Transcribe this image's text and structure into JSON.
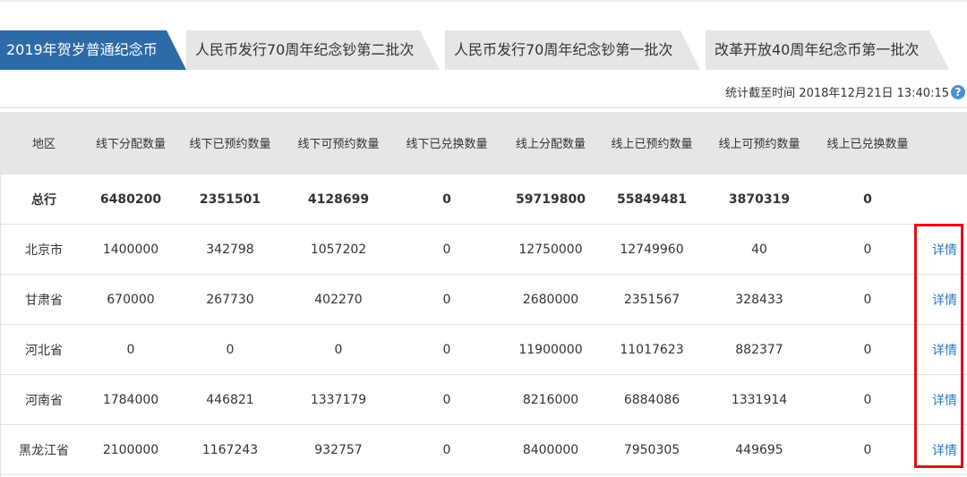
{
  "tabs": [
    {
      "label": "2019年贺岁普通纪念币",
      "active": true
    },
    {
      "label": "人民币发行70周年纪念钞第二批次",
      "active": false
    },
    {
      "label": "人民币发行70周年纪念钞第一批次",
      "active": false
    },
    {
      "label": "改革开放40周年纪念币第一批次",
      "active": false
    }
  ],
  "stat_time": "统计截至时间 2018年12月21日 13:40:15",
  "help_icon": "?",
  "columns": [
    "地区",
    "线下分配数量",
    "线下已预约数量",
    "线下可预约数量",
    "线下已兑换数量",
    "线上分配数量",
    "线上已预约数量",
    "线上可预约数量",
    "线上已兑换数量",
    ""
  ],
  "total_row": [
    "总行",
    "6480200",
    "2351501",
    "4128699",
    "0",
    "59719800",
    "55849481",
    "3870319",
    "0"
  ],
  "rows": [
    [
      "北京市",
      "1400000",
      "342798",
      "1057202",
      "0",
      "12750000",
      "12749960",
      "40",
      "0"
    ],
    [
      "甘肃省",
      "670000",
      "267730",
      "402270",
      "0",
      "2680000",
      "2351567",
      "328433",
      "0"
    ],
    [
      "河北省",
      "0",
      "0",
      "0",
      "0",
      "11900000",
      "11017623",
      "882377",
      "0"
    ],
    [
      "河南省",
      "1784000",
      "446821",
      "1337179",
      "0",
      "8216000",
      "6884086",
      "1331914",
      "0"
    ],
    [
      "黑龙江省",
      "2100000",
      "1167243",
      "932757",
      "0",
      "8400000",
      "7950305",
      "449695",
      "0"
    ]
  ],
  "detail_label": "详情",
  "colors": {
    "tab_active": "#2d6aa7",
    "tab_inactive": "#e6e6e6",
    "link": "#2b79c2",
    "highlight": "#e2101c"
  }
}
